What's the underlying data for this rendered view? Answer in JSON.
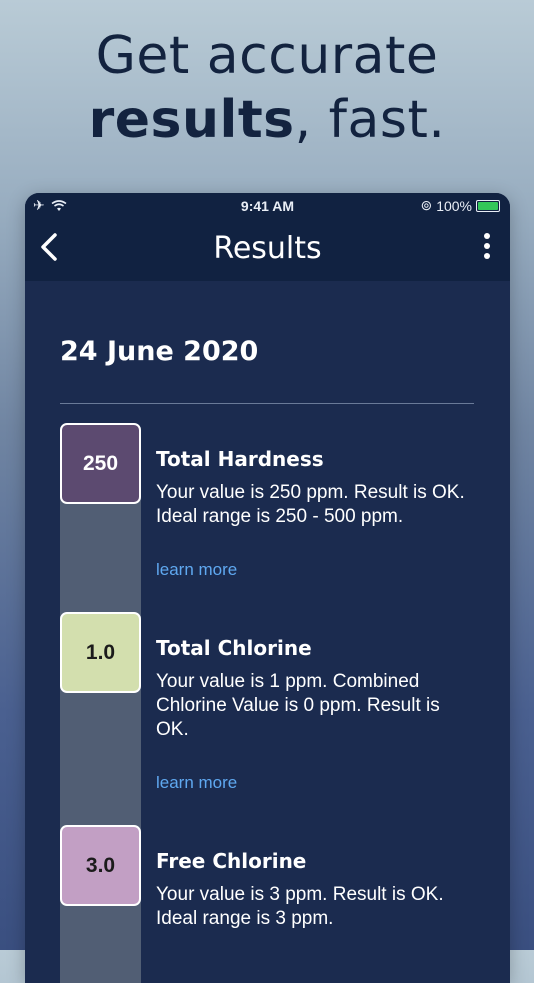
{
  "headline": {
    "line1": "Get accurate",
    "line2_bold": "results",
    "line2_rest": ", fast."
  },
  "statusbar": {
    "time": "9:41 AM",
    "battery": "100%",
    "icons": [
      "airplane-icon",
      "wifi-icon",
      "orientation-lock-icon",
      "battery-icon"
    ]
  },
  "navbar": {
    "title": "Results",
    "back_icon": "chevron-left-icon",
    "more_icon": "more-vertical-icon"
  },
  "date": "24 June 2020",
  "results": [
    {
      "value": "250",
      "badge_color": "#5c4a70",
      "badge_text_color": "#ffffff",
      "title": "Total Hardness",
      "description": "Your value is 250 ppm. Result is OK. Ideal range is 250 - 500 ppm.",
      "link": "learn more"
    },
    {
      "value": "1.0",
      "badge_color": "#d3dfae",
      "badge_text_color": "#1b1b1b",
      "title": "Total Chlorine",
      "description": "Your value is 1 ppm. Combined Chlorine Value is 0 ppm. Result is OK.",
      "link": "learn more"
    },
    {
      "value": "3.0",
      "badge_color": "#c29fc4",
      "badge_text_color": "#1b1b1b",
      "title": "Free Chlorine",
      "description": "Your value is 3 ppm. Result is OK. Ideal range is 3 ppm.",
      "link": ""
    }
  ]
}
